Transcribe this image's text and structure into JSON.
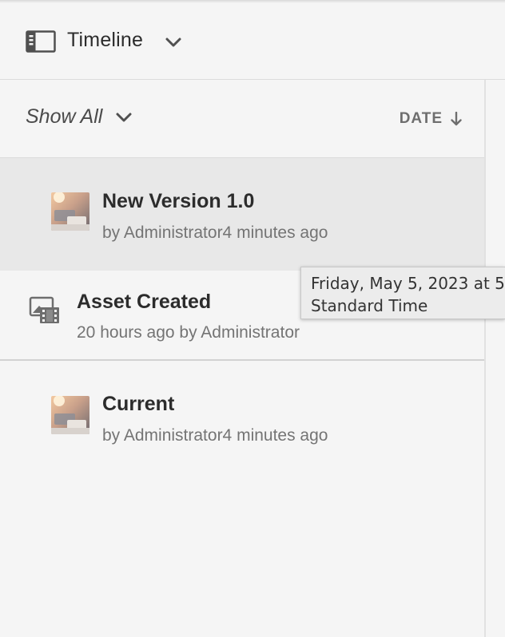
{
  "header": {
    "title": "Timeline"
  },
  "filter": {
    "show_label": "Show All",
    "sort_label": "DATE"
  },
  "items": [
    {
      "title": "New Version 1.0",
      "meta": "by Administrator4 minutes ago",
      "icon": "image-thumbnail",
      "selected": true
    },
    {
      "title": "Asset Created",
      "meta": "20 hours ago by Administrator",
      "icon": "asset-created-icon",
      "selected": false
    },
    {
      "title": "Current",
      "meta": "by Administrator4 minutes ago",
      "icon": "image-thumbnail",
      "selected": false
    }
  ],
  "tooltip": {
    "line1": "Friday, May 5, 2023 at 5",
    "line2": "Standard Time"
  },
  "colors": {
    "background": "#f5f5f5",
    "selected_row": "#e8e8e8",
    "text_primary": "#2c2c2c",
    "text_secondary": "#747474"
  }
}
